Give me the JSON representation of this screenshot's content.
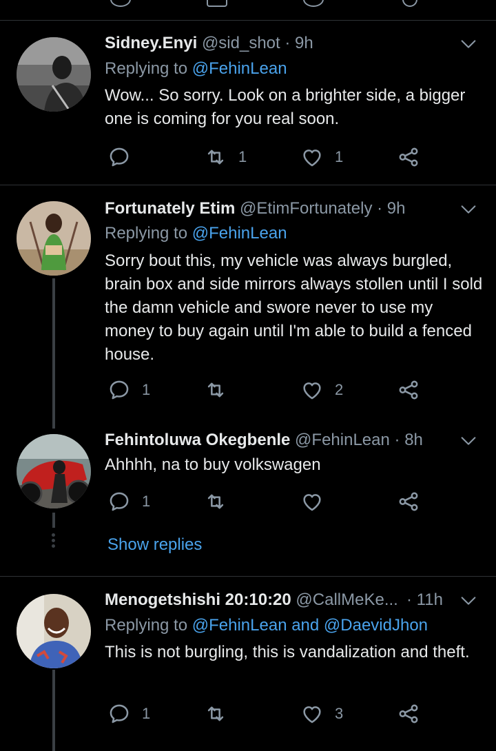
{
  "tweets": [
    {
      "name": "Sidney.Enyi",
      "handle": "@sid_shot",
      "sep": "·",
      "time": "9h",
      "replying_label": "Replying to",
      "replying_to": "@FehinLean",
      "text": "Wow... So sorry. Look on a brighter side, a bigger one is coming for you real soon.",
      "reply_count": "",
      "retweet_count": "1",
      "like_count": "1"
    },
    {
      "name": "Fortunately Etim",
      "handle": "@EtimFortunately",
      "sep": "·",
      "time": "9h",
      "replying_label": "Replying to",
      "replying_to": "@FehinLean",
      "text": "Sorry bout this, my vehicle was always burgled, brain box and side mirrors always stollen until I sold the damn vehicle and swore never to use my money to buy again until I'm able to build a fenced house.",
      "reply_count": "1",
      "retweet_count": "",
      "like_count": "2"
    },
    {
      "name": "Fehintoluwa Okegbenle",
      "handle": "@FehinLean",
      "sep": "·",
      "time": "8h",
      "text": "Ahhhh, na to buy volkswagen",
      "reply_count": "1",
      "retweet_count": "",
      "like_count": ""
    },
    {
      "name": "Menogetshishi 20:10:20",
      "handle": "@CallMeKe...",
      "sep": "·",
      "time": "11h",
      "replying_label": "Replying to",
      "replying_to": "@FehinLean and @DaevidJhon",
      "text": "This is not burgling, this is vandalization and theft.",
      "reply_count": "1",
      "retweet_count": "",
      "like_count": "3"
    }
  ],
  "show_replies": "Show replies",
  "colors": {
    "background": "#000000",
    "accent": "#4aa3ec",
    "muted": "#8b98a5"
  },
  "icons": [
    "reply-icon",
    "retweet-icon",
    "like-icon",
    "share-icon",
    "chevron-down-icon"
  ]
}
